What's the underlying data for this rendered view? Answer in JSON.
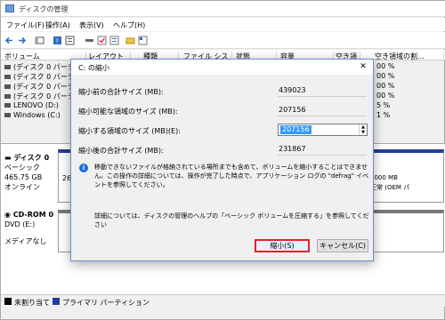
{
  "window": {
    "title": "ディスクの管理"
  },
  "menu": [
    "ファイル(F)",
    "操作(A)",
    "表示(V)",
    "ヘルプ(H)"
  ],
  "list": {
    "columns": [
      "ボリューム",
      "レイアウト",
      "種類",
      "ファイル システム",
      "状態",
      "容量",
      "空き領域",
      "空き領域の割..."
    ],
    "volumes": [
      "(ディスク 0 パーティション",
      "(ディスク 0 パーティション",
      "(ディスク 0 パーティション",
      "(ディスク 0 パーティション",
      "LENOVO (D:)",
      "Windows (C:)"
    ],
    "free_pct": [
      "00 %",
      "00 %",
      "00 %",
      "00 %",
      "5 %",
      "1 %"
    ]
  },
  "disks": [
    {
      "name": "ディスク 0",
      "type": "ベーシック",
      "size": "465.75 GB",
      "status": "オンライン",
      "part_prefix": "26",
      "right_part": {
        "size": "1000 MB",
        "status": "正常 (OEM パ"
      }
    },
    {
      "name": "CD-ROM 0",
      "type": "DVD (E:)",
      "status": "メディアなし"
    }
  ],
  "legend": [
    {
      "label": "未割り当て",
      "color": "#000000"
    },
    {
      "label": "プライマリ パーティション",
      "color": "#1f3fa0"
    }
  ],
  "dialog": {
    "title": "C: の縮小",
    "close": "✕",
    "fields": [
      {
        "label": "縮小前の合計サイズ (MB):",
        "value": "439023"
      },
      {
        "label": "縮小可能な領域のサイズ (MB):",
        "value": "207156"
      },
      {
        "label": "縮小する領域のサイズ (MB)(E):",
        "value": "207156"
      },
      {
        "label": "縮小後の合計サイズ (MB):",
        "value": "231867"
      }
    ],
    "message": "移動できないファイルが格納されている場所までも含めて、ボリュームを縮小することはできません。この操作の詳細については、操作が完了した時点で、アプリケーション ログの \"defrag\" イベントを参照してください。",
    "help": "詳細については、ディスクの管理のヘルプの「ベーシック ボリュームを圧縮する」を参照してください",
    "ok": "縮小(S)",
    "cancel": "キャンセル(C)"
  }
}
